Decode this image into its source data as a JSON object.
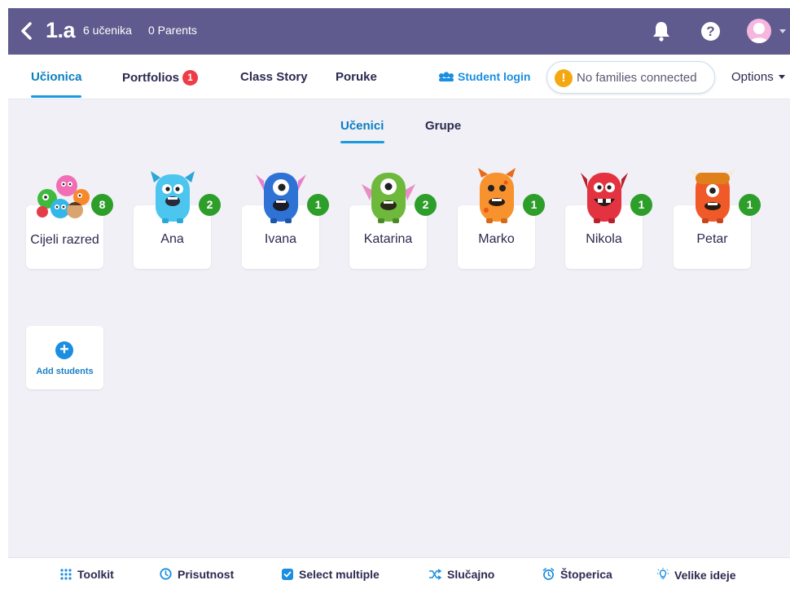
{
  "header": {
    "class_name": "1.a",
    "student_count": "6 učenika",
    "parent_count": "0 Parents",
    "bg_color": "#5f5b8e"
  },
  "nav": {
    "tabs": [
      {
        "label": "Učionica",
        "active": true
      },
      {
        "label": "Portfolios",
        "badge": "1"
      },
      {
        "label": "Class Story"
      },
      {
        "label": "Poruke"
      }
    ],
    "student_login": "Student login",
    "families": "No families connected",
    "options": "Options",
    "accent": "#1a8ee0"
  },
  "subtabs": [
    {
      "label": "Učenici",
      "active": true
    },
    {
      "label": "Grupe"
    }
  ],
  "cards": [
    {
      "name": "Cijeli razred",
      "points": "8",
      "monster": "group-monsters-icon"
    },
    {
      "name": "Ana",
      "points": "2",
      "monster": "cyan-monster-icon"
    },
    {
      "name": "Ivana",
      "points": "1",
      "monster": "blue-monster-icon"
    },
    {
      "name": "Katarina",
      "points": "2",
      "monster": "green-monster-icon"
    },
    {
      "name": "Marko",
      "points": "1",
      "monster": "orange-monster-icon"
    },
    {
      "name": "Nikola",
      "points": "1",
      "monster": "red-monster-icon"
    },
    {
      "name": "Petar",
      "points": "1",
      "monster": "viking-monster-icon"
    }
  ],
  "add_students": "Add students",
  "toolbar": {
    "items": [
      {
        "label": "Toolkit",
        "icon": "grid-icon"
      },
      {
        "label": "Prisutnost",
        "icon": "clock-icon"
      },
      {
        "label": "Select multiple",
        "icon": "checkbox-icon"
      },
      {
        "label": "Slučajno",
        "icon": "shuffle-icon"
      },
      {
        "label": "Štoperica",
        "icon": "alarm-icon"
      },
      {
        "label": "Velike ideje",
        "icon": "lightbulb-icon"
      }
    ]
  }
}
